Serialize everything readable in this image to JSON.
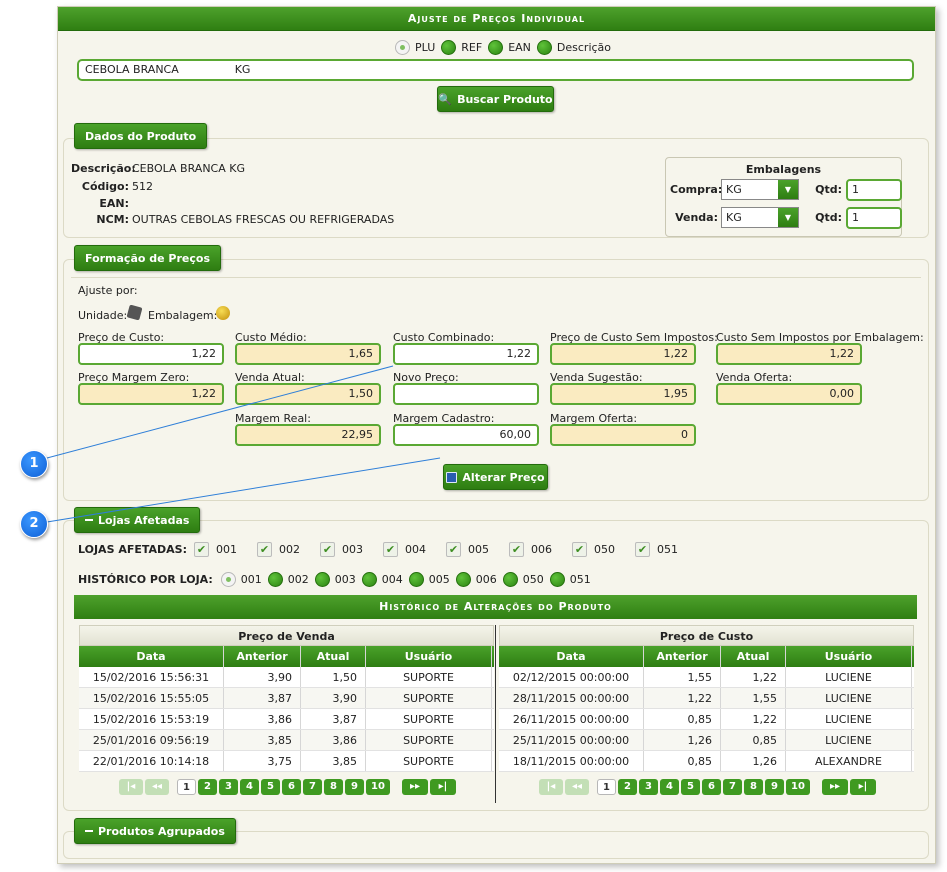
{
  "window": {
    "title": "Ajuste de Preços Individual"
  },
  "search": {
    "options": [
      "PLU",
      "REF",
      "EAN",
      "Descrição"
    ],
    "selected": "PLU",
    "value": "CEBOLA BRANCA                KG",
    "button_label": "Buscar Produto"
  },
  "dados": {
    "tab_label": "Dados do Produto",
    "descricao_label": "Descrição:",
    "descricao": "CEBOLA BRANCA KG",
    "codigo_label": "Código:",
    "codigo": "512",
    "ean_label": "EAN:",
    "ean": "",
    "ncm_label": "NCM:",
    "ncm": "OUTRAS CEBOLAS FRESCAS OU REFRIGERADAS",
    "embalagens": {
      "title": "Embalagens",
      "compra_label": "Compra:",
      "compra": "KG",
      "venda_label": "Venda:",
      "venda": "KG",
      "qtd_label": "Qtd:",
      "qtd_compra": "1",
      "qtd_venda": "1"
    }
  },
  "formacao": {
    "tab_label": "Formação de Preços",
    "ajuste_por": "Ajuste por:",
    "unidade": "Unidade:",
    "embalagem": "Embalagem:",
    "fields": {
      "preco_custo": {
        "label": "Preço de Custo:",
        "value": "1,22"
      },
      "custo_medio": {
        "label": "Custo Médio:",
        "value": "1,65"
      },
      "custo_combinado": {
        "label": "Custo Combinado:",
        "value": "1,22"
      },
      "preco_custo_sem_impostos": {
        "label": "Preço de Custo Sem Impostos:",
        "value": "1,22"
      },
      "custo_sem_impostos_embalagem": {
        "label": "Custo Sem Impostos por Embalagem:",
        "value": "1,22"
      },
      "preco_margem_zero": {
        "label": "Preço Margem Zero:",
        "value": "1,22"
      },
      "venda_atual": {
        "label": "Venda Atual:",
        "value": "1,50"
      },
      "novo_preco": {
        "label": "Novo Preço:",
        "value": ""
      },
      "venda_sugestao": {
        "label": "Venda Sugestão:",
        "value": "1,95"
      },
      "venda_oferta": {
        "label": "Venda Oferta:",
        "value": "0,00"
      },
      "margem_real": {
        "label": "Margem Real:",
        "value": "22,95"
      },
      "margem_cadastro": {
        "label": "Margem Cadastro:",
        "value": "60,00"
      },
      "margem_oferta": {
        "label": "Margem Oferta:",
        "value": "0"
      }
    },
    "alterar_label": "Alterar Preço"
  },
  "lojas": {
    "tab_label": "Lojas Afetadas",
    "afetadas_label": "LOJAS AFETADAS:",
    "lojas": [
      "001",
      "002",
      "003",
      "004",
      "005",
      "006",
      "050",
      "051"
    ],
    "historico_label": "HISTÓRICO POR LOJA:",
    "historico_selected": "001"
  },
  "historico": {
    "title": "Histórico de Alterações do Produto",
    "venda": {
      "caption": "Preço de Venda",
      "columns": [
        "Data",
        "Anterior",
        "Atual",
        "Usuário"
      ],
      "rows": [
        [
          "15/02/2016 15:56:31",
          "3,90",
          "1,50",
          "SUPORTE"
        ],
        [
          "15/02/2016 15:55:05",
          "3,87",
          "3,90",
          "SUPORTE"
        ],
        [
          "15/02/2016 15:53:19",
          "3,86",
          "3,87",
          "SUPORTE"
        ],
        [
          "25/01/2016 09:56:19",
          "3,85",
          "3,86",
          "SUPORTE"
        ],
        [
          "22/01/2016 10:14:18",
          "3,75",
          "3,85",
          "SUPORTE"
        ]
      ]
    },
    "custo": {
      "caption": "Preço de Custo",
      "columns": [
        "Data",
        "Anterior",
        "Atual",
        "Usuário"
      ],
      "rows": [
        [
          "02/12/2015 00:00:00",
          "1,55",
          "1,22",
          "LUCIENE"
        ],
        [
          "28/11/2015 00:00:00",
          "1,22",
          "1,55",
          "LUCIENE"
        ],
        [
          "26/11/2015 00:00:00",
          "0,85",
          "1,22",
          "LUCIENE"
        ],
        [
          "25/11/2015 00:00:00",
          "1,26",
          "0,85",
          "LUCIENE"
        ],
        [
          "18/11/2015 00:00:00",
          "0,85",
          "1,26",
          "ALEXANDRE"
        ]
      ]
    },
    "pager": {
      "first": "|◂",
      "prev": "◂◂",
      "next": "▸▸",
      "last": "▸|",
      "pages": [
        "1",
        "2",
        "3",
        "4",
        "5",
        "6",
        "7",
        "8",
        "9",
        "10"
      ],
      "current": "1"
    }
  },
  "agrupados": {
    "tab_label": "Produtos Agrupados"
  },
  "callouts": [
    "1",
    "2"
  ],
  "colors": {
    "accent": "#3a8f1c",
    "readonly_field": "#faebc1",
    "callout": "#1a73e8"
  }
}
